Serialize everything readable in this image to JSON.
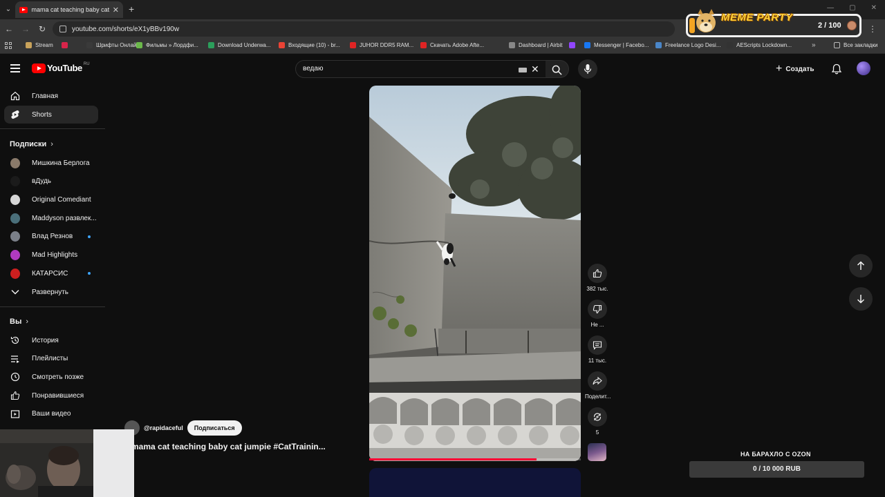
{
  "browser": {
    "tab_title": "mama cat teaching baby cat ju",
    "url": "youtube.com/shorts/eX1yBBv190w",
    "bookmarks": [
      {
        "label": "Stream",
        "color": "#c8a25a"
      },
      {
        "label": "",
        "color": "#d8244a"
      },
      {
        "label": "Шрифты Онлайн",
        "color": "#3a3a3a"
      },
      {
        "label": "Фильмы » Лордфи...",
        "color": "#6bb84a"
      },
      {
        "label": "Download Underwa...",
        "color": "#2b9f5b"
      },
      {
        "label": "Входящие (10) - br...",
        "color": "#ea4335"
      },
      {
        "label": "JUHOR DDR5 RAM...",
        "color": "#e02424"
      },
      {
        "label": "Скачать Adobe Afte...",
        "color": "#e02424"
      },
      {
        "label": "Dashboard | Airbit",
        "color": "#888888"
      },
      {
        "label": "",
        "color": "#9146ff"
      },
      {
        "label": "Messenger | Facebo...",
        "color": "#1877f2"
      },
      {
        "label": "Freelance Logo Desi...",
        "color": "#4a86c8"
      },
      {
        "label": "AEScripts Lockdown...",
        "color": "#333333"
      }
    ],
    "bookmarks_more": "»",
    "all_bookmarks": "Все закладки"
  },
  "meme_party": {
    "title": "MEME PARTY",
    "count": "2 / 100"
  },
  "masthead": {
    "logo_text": "YouTube",
    "region": "RU",
    "search_query": "ведаю",
    "create_label": "Создать"
  },
  "sidebar": {
    "home": "Главная",
    "shorts": "Shorts",
    "subscriptions_heading": "Подписки",
    "channels": [
      {
        "name": "Мишкина Берлога",
        "color": "#8a7a6a",
        "dot": false
      },
      {
        "name": "вДудь",
        "color": "#1b1b1b",
        "dot": false
      },
      {
        "name": "Original Comediant",
        "color": "#d6d6d6",
        "dot": false
      },
      {
        "name": "Maddyson развлек...",
        "color": "#4a6f7a",
        "dot": false
      },
      {
        "name": "Влад Резнов",
        "color": "#7a7f88",
        "dot": true
      },
      {
        "name": "Mad Highlights",
        "color": "#b03ac0",
        "dot": false
      },
      {
        "name": "КАТАРСИС",
        "color": "#cc1f1f",
        "dot": true
      }
    ],
    "expand": "Развернуть",
    "you_heading": "Вы",
    "you_items": [
      "История",
      "Плейлисты",
      "Смотреть позже",
      "Понравившиеся",
      "Ваши видео"
    ]
  },
  "short": {
    "channel": "@rapidaceful",
    "subscribe": "Подписаться",
    "title": "mama cat teaching baby cat jumpie #CatTrainin...",
    "progress": 0.79,
    "actions": {
      "likes": "382 тыс.",
      "dislike": "Не ...",
      "comments": "11 тыс.",
      "share": "Поделит...",
      "remix": "5"
    }
  },
  "donation_goal": {
    "title": "НА БАРАХЛО С OZON",
    "current": 0,
    "target": 10000,
    "text": "0 / 10 000 RUB"
  }
}
